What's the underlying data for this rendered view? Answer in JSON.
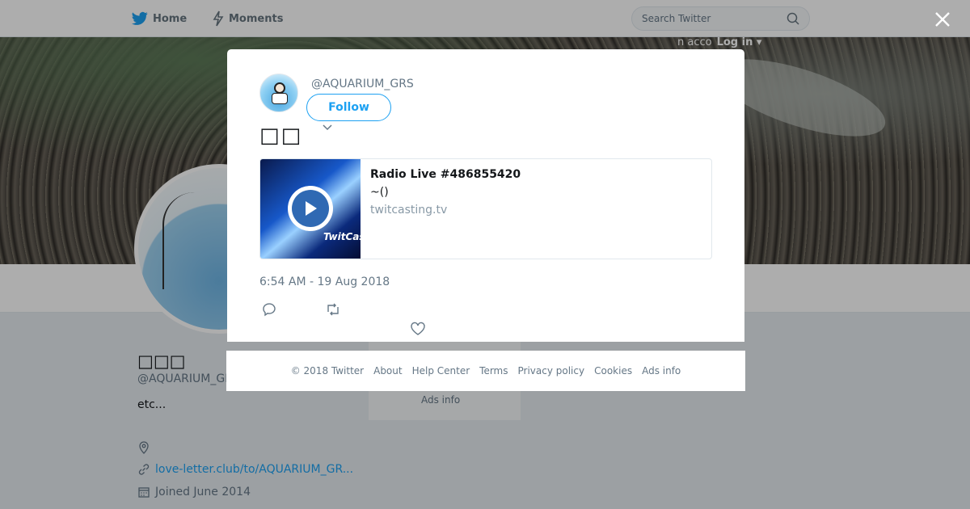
{
  "nav": {
    "home_label": "Home",
    "moments_label": "Moments",
    "search_placeholder": "Search Twitter"
  },
  "login": {
    "prefix": "n acco",
    "label": "Log in ▾"
  },
  "profile": {
    "name": "□□□",
    "handle": "@AQUARIUM_GI",
    "bio": "etc...",
    "url": "love-letter.club/to/AQUARIUM_GR...",
    "joined": "Joined June 2014"
  },
  "sidebar": {
    "ads_info": "Ads info"
  },
  "tweet": {
    "handle": "@AQUARIUM_GRS",
    "follow_label": "Follow",
    "text": "□□",
    "card": {
      "title": "Radio Live #486855420",
      "description": "~()",
      "domain": "twitcasting.tv",
      "brand": "TwitCas"
    },
    "timestamp": "6:54 AM - 19 Aug 2018"
  },
  "footer": {
    "copyright": "© 2018 Twitter",
    "links": [
      "About",
      "Help Center",
      "Terms",
      "Privacy policy",
      "Cookies",
      "Ads info"
    ]
  },
  "colors": {
    "brand": "#1da1f2",
    "text": "#14171a",
    "secondary": "#657786"
  },
  "icons": {
    "home": "bird-icon",
    "moments": "lightning-icon",
    "search": "search-icon",
    "close": "close-icon",
    "reply": "reply-icon",
    "retweet": "retweet-icon",
    "like": "heart-icon",
    "chevron": "chevron-down-icon",
    "play": "play-icon",
    "location": "location-icon",
    "link": "link-icon",
    "calendar": "calendar-icon"
  }
}
